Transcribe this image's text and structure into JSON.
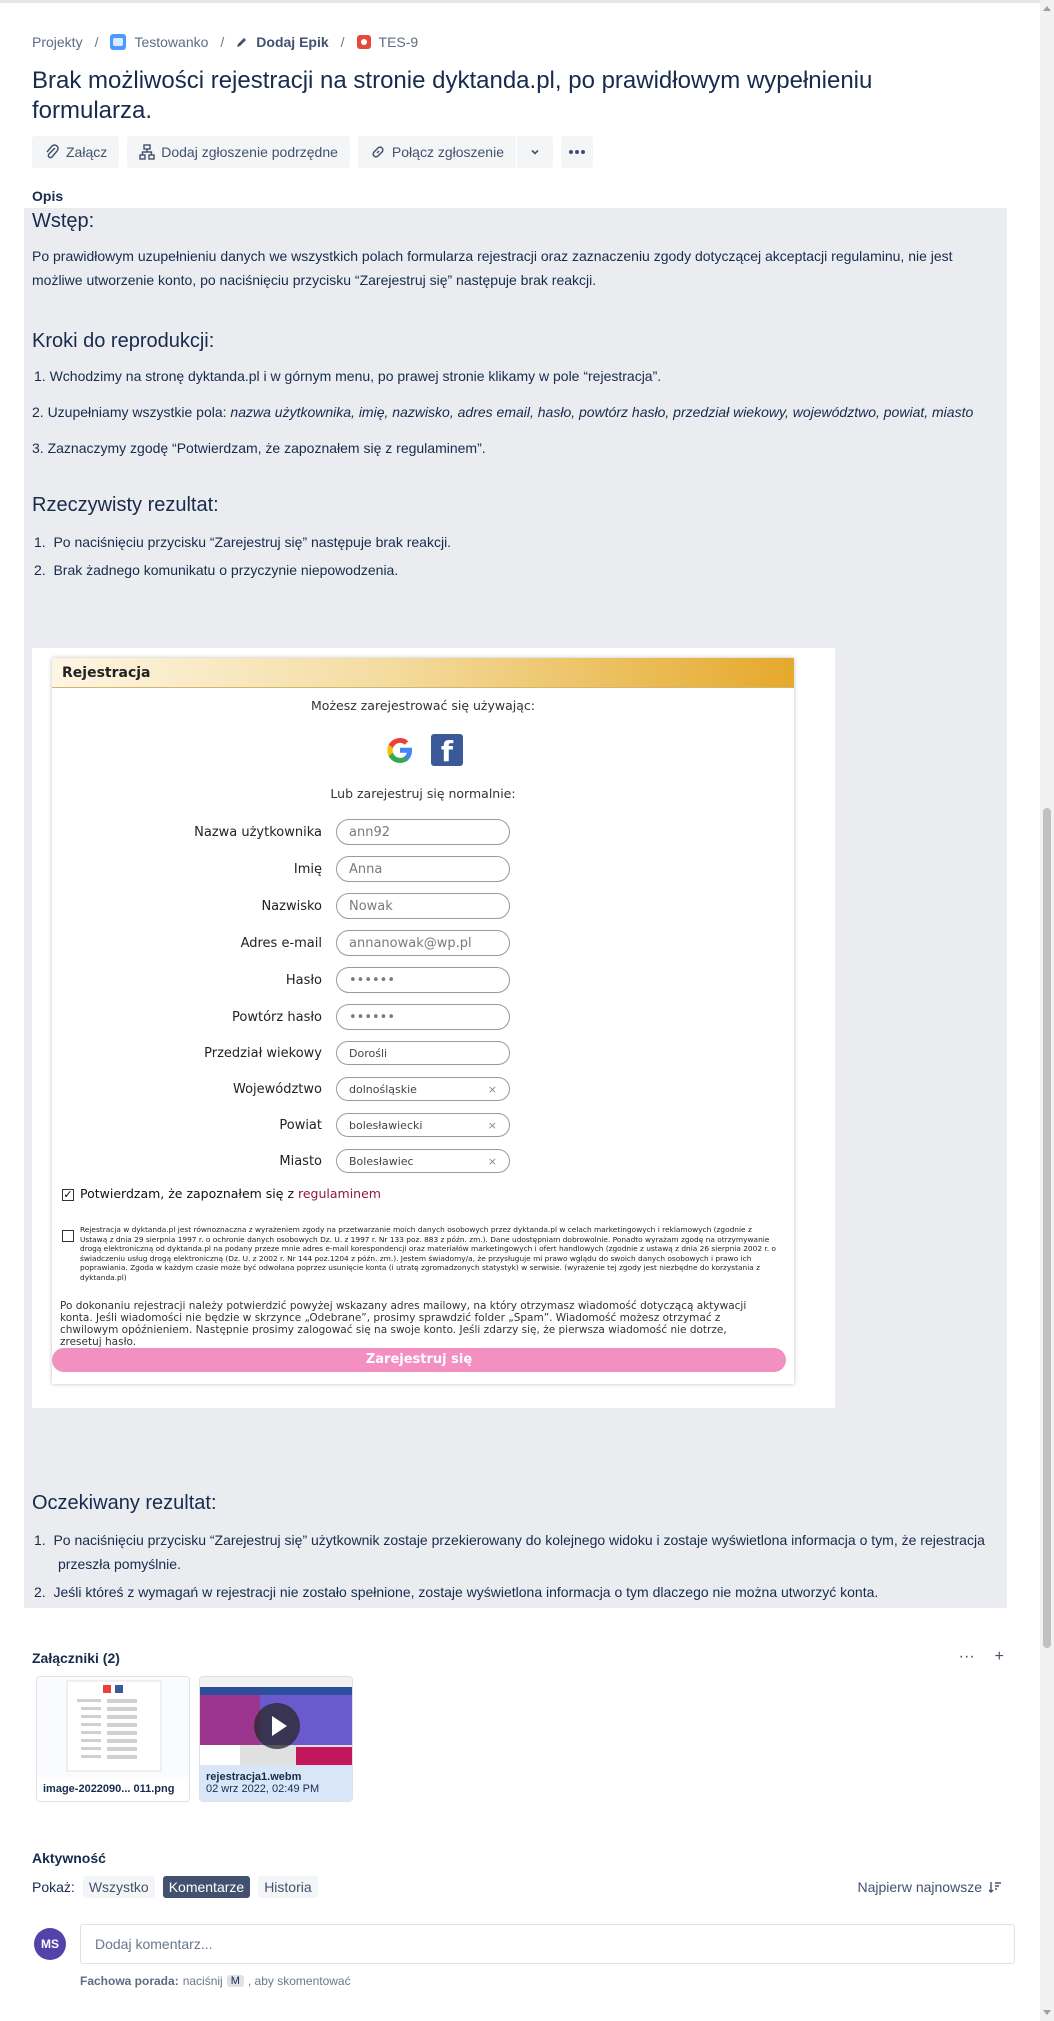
{
  "breadcrumb": {
    "projects": "Projekty",
    "project": "Testowanko",
    "epic": "Dodaj Epik",
    "issue_key": "TES-9"
  },
  "issue": {
    "title": "Brak możliwości rejestracji na stronie dyktanda.pl, po prawidłowym wypełnieniu formularza."
  },
  "toolbar": {
    "attach": "Załącz",
    "add_child": "Dodaj zgłoszenie podrzędne",
    "link_issue": "Połącz zgłoszenie"
  },
  "description": {
    "label": "Opis",
    "intro_heading": "Wstęp:",
    "intro_text": "Po prawidłowym uzupełnieniu danych we wszystkich polach formularza rejestracji oraz zaznaczeniu zgody dotyczącej akceptacji regulaminu, nie jest możliwe utworzenie konto, po naciśnięciu przycisku “Zarejestruj się” następuje brak reakcji.",
    "steps_heading": "Kroki do reprodukcji:",
    "step1": "1. Wchodzimy na stronę dyktanda.pl i w górnym menu, po prawej stronie klikamy w pole “rejestracja”.",
    "step2_prefix": "2. Uzupełniamy wszystkie pola: ",
    "step2_fields": "nazwa użytkownika, imię, nazwisko, adres email, hasło, powtórz hasło, przedział wiekowy, województwo, powiat, miasto",
    "step3": "3. Zaznaczymy zgodę “Potwierdzam, że zapoznałem się z regulaminem”.",
    "actual_heading": "Rzeczywisty rezultat:",
    "actual1": "Po naciśnięciu przycisku “Zarejestruj się” następuje brak reakcji.",
    "actual2": "Brak żadnego komunikatu o przyczynie niepowodzenia.",
    "expected_heading": "Oczekiwany rezultat:",
    "expected1": "Po naciśnięciu przycisku “Zarejestruj się” użytkownik zostaje przekierowany do kolejnego widoku i zostaje wyświetlona informacja o tym, że rejestracja przeszła pomyślnie.",
    "expected2": "Jeśli któreś z wymagań w rejestracji nie zostało spełnione, zostaje wyświetlona informacja o tym dlaczego nie można utworzyć konta."
  },
  "screenshot": {
    "header": "Rejestracja",
    "register_with": "Możesz zarejestrować się używając:",
    "or_normal": "Lub zarejestruj się normalnie:",
    "fields": [
      {
        "label": "Nazwa użytkownika",
        "value": "ann92"
      },
      {
        "label": "Imię",
        "value": "Anna"
      },
      {
        "label": "Nazwisko",
        "value": "Nowak"
      },
      {
        "label": "Adres e-mail",
        "value": "annanowak@wp.pl"
      },
      {
        "label": "Hasło",
        "value": "••••••"
      },
      {
        "label": "Powtórz hasło",
        "value": "••••••"
      },
      {
        "label": "Przedział wiekowy",
        "value": "Dorośli"
      },
      {
        "label": "Województwo",
        "value": "dolnośląskie"
      },
      {
        "label": "Powiat",
        "value": "bolesławiecki"
      },
      {
        "label": "Miasto",
        "value": "Bolesławiec"
      }
    ],
    "consent_text": "Potwierdzam, że zapoznałem się z ",
    "consent_link": "regulaminem",
    "legal_text": "Rejestracja w dyktanda.pl jest równoznaczna z wyrażeniem zgody na przetwarzanie moich danych osobowych przez dyktanda.pl w celach marketingowych i reklamowych (zgodnie z Ustawą z dnia 29 sierpnia 1997 r. o ochronie danych osobowych Dz. U. z 1997 r. Nr 133 poz. 883 z późn. zm.). Dane udostępniam dobrowolnie. Ponadto wyrażam zgodę na otrzymywanie drogą elektroniczną od dyktanda.pl na podany przeze mnie adres e-mail korespondencji oraz materiałów marketingowych i ofert handlowych (zgodnie z ustawą z dnia 26 sierpnia 2002 r. o świadczeniu usług drogą elektroniczną (Dz. U. z 2002 r. Nr 144 poz.1204 z późn. zm.). Jestem świadomy/a, że przysługuje mi prawo wglądu do swoich danych osobowych i prawo ich poprawiania. Zgoda w każdym czasie może być odwołana poprzez usunięcie konta (i utratę zgromadzonych statystyk) w serwisie. (wyrażenie tej zgody jest niezbędne do korzystania z dyktanda.pl)",
    "note_text": "Po dokonaniu rejestracji należy potwierdzić powyżej wskazany adres mailowy, na który otrzymasz wiadomość dotyczącą aktywacji konta. Jeśli wiadomości nie będzie w skrzynce „Odebrane”, prosimy sprawdzić folder „Spam”. Wiadomość możesz otrzymać z chwilowym opóźnieniem. Następnie prosimy zalogować się na swoje konto. Jeśli zdarzy się, że pierwsza wiadomość nie dotrze, zresetuj hasło.",
    "register_button": "Zarejestruj się"
  },
  "attachments": {
    "header": "Załączniki (2)",
    "items": [
      {
        "name": "image-2022090... 011.png",
        "date": ""
      },
      {
        "name": "rejestracja1.webm",
        "date": "02 wrz 2022, 02:49 PM"
      }
    ]
  },
  "activity": {
    "title": "Aktywność",
    "show_label": "Pokaż:",
    "filters": [
      "Wszystko",
      "Komentarze",
      "Historia"
    ],
    "sort": "Najpierw najnowsze",
    "avatar_initials": "MS",
    "comment_placeholder": "Dodaj komentarz...",
    "tip_bold": "Fachowa porada:",
    "tip_pre": "naciśnij",
    "tip_key": "M",
    "tip_post": ", aby skomentować"
  },
  "colors": {
    "accent": "#0052cc",
    "description_bg": "#ebecf0",
    "register_button": "#f48fc1",
    "active_filter": "#42526e",
    "avatar": "#5243aa"
  }
}
